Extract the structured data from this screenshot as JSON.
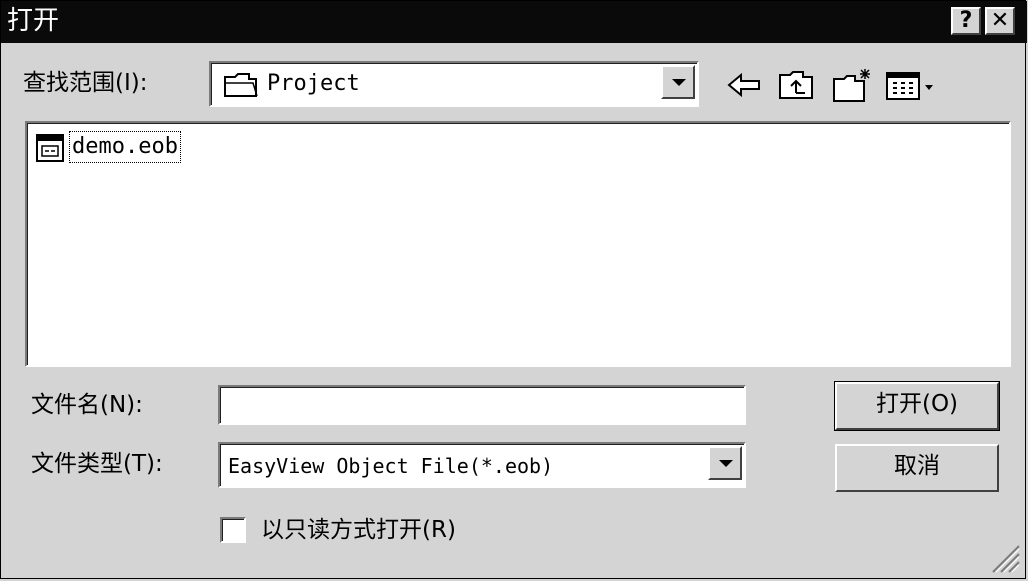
{
  "window": {
    "title": "打开",
    "help_button": "?",
    "close_button": "✕"
  },
  "lookin": {
    "label": "查找范围(I):",
    "value": "Project"
  },
  "toolbar": {
    "icons": [
      "back-icon",
      "up-folder-icon",
      "new-folder-icon",
      "view-menu-icon"
    ]
  },
  "files": [
    {
      "name": "demo.eob",
      "icon": "eob-file-icon"
    }
  ],
  "filename": {
    "label": "文件名(N):",
    "value": ""
  },
  "filetype": {
    "label": "文件类型(T):",
    "value": "EasyView Object File(*.eob)"
  },
  "readonly": {
    "label": "以只读方式打开(R)",
    "checked": false
  },
  "buttons": {
    "open": "打开(O)",
    "cancel": "取消"
  }
}
